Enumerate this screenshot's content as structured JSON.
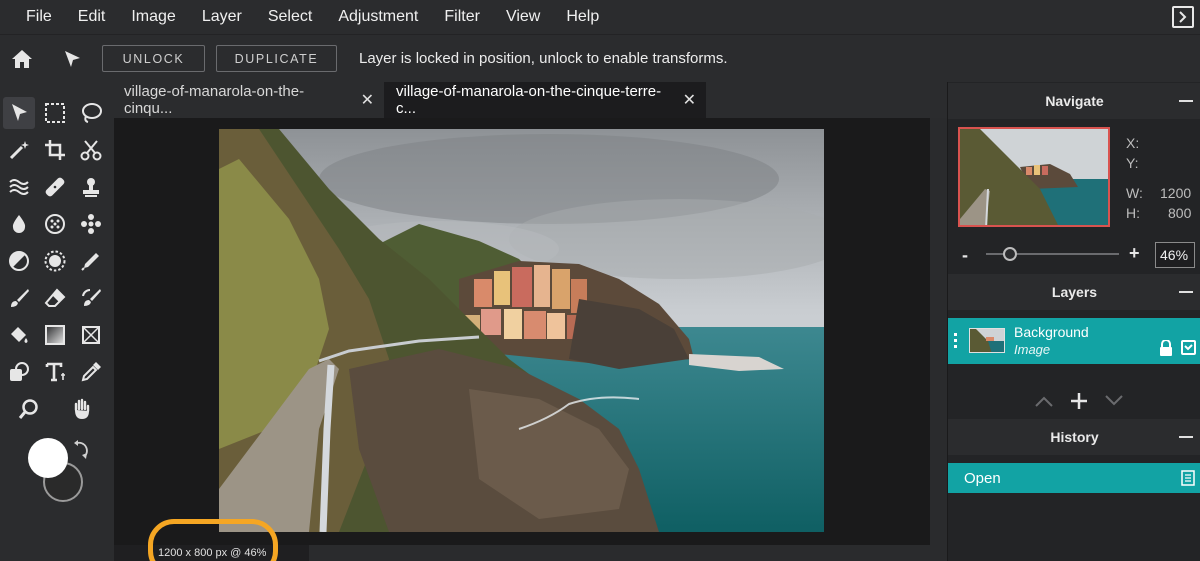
{
  "menu": [
    "File",
    "Edit",
    "Image",
    "Layer",
    "Select",
    "Adjustment",
    "Filter",
    "View",
    "Help"
  ],
  "options": {
    "unlock_label": "UNLOCK",
    "duplicate_label": "DUPLICATE",
    "message": "Layer is locked in position, unlock to enable transforms."
  },
  "tabs": [
    {
      "label": "village-of-manarola-on-the-cinqu...",
      "close": "✕"
    },
    {
      "label": "village-of-manarola-on-the-cinque-terre-c...",
      "close": "✕"
    }
  ],
  "status": {
    "text": "1200 x 800 px @ 46%"
  },
  "navigate": {
    "title": "Navigate",
    "x_label": "X:",
    "y_label": "Y:",
    "w_label": "W:",
    "w_value": "1200",
    "h_label": "H:",
    "h_value": "800",
    "zoom_minus": "-",
    "zoom_plus": "+",
    "zoom": "46%"
  },
  "layers": {
    "title": "Layers",
    "items": [
      {
        "name": "Background",
        "type": "Image"
      }
    ]
  },
  "history": {
    "title": "History",
    "items": [
      {
        "label": "Open"
      }
    ]
  },
  "colors": {
    "accent": "#12a3a4",
    "highlight": "#f5a623",
    "panel": "#2b2c2e"
  }
}
